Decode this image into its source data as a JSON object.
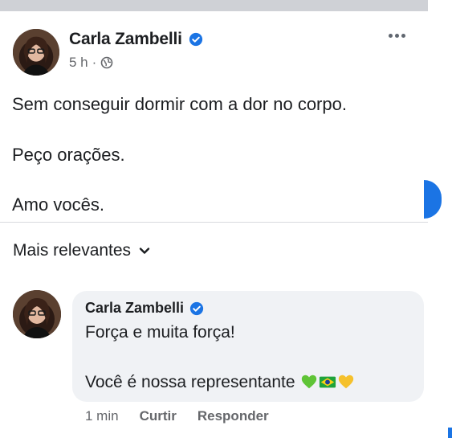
{
  "post": {
    "author": "Carla Zambelli",
    "time": "5 h",
    "separator": "·",
    "lines": [
      "Sem conseguir dormir com a dor no corpo.",
      "Peço orações.",
      "Amo vocês."
    ]
  },
  "comments_sort": {
    "label": "Mais relevantes"
  },
  "comment": {
    "author": "Carla Zambelli",
    "line1": "Força e muita força!",
    "line2": "Você é nossa representante",
    "emojis": [
      "green-heart",
      "brazil-flag",
      "yellow-heart"
    ],
    "time": "1 min",
    "like_label": "Curtir",
    "reply_label": "Responder"
  },
  "colors": {
    "accent": "#1b74e4",
    "text": "#1c1e21",
    "muted": "#65676b",
    "bubble": "#f0f2f5"
  }
}
